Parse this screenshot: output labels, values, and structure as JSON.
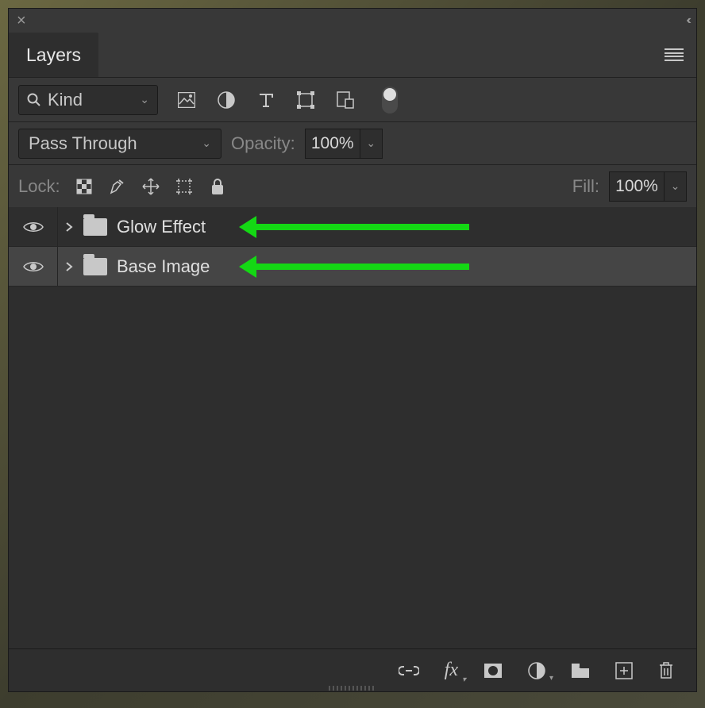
{
  "window": {
    "close": "×",
    "collapse": "‹‹"
  },
  "tabs": {
    "active": "Layers"
  },
  "filter": {
    "kind_label": "Kind",
    "icons": {
      "pixel": "pixel-layer-filter",
      "adjustment": "adjustment-layer-filter",
      "type": "type-layer-filter",
      "shape": "shape-layer-filter",
      "smart": "smart-object-filter"
    }
  },
  "blend": {
    "mode": "Pass Through",
    "opacity_label": "Opacity:",
    "opacity_value": "100%"
  },
  "lock": {
    "label": "Lock:",
    "fill_label": "Fill:",
    "fill_value": "100%"
  },
  "layers": [
    {
      "name": "Glow Effect",
      "type": "group",
      "selected": false,
      "visible": true,
      "annotated": true
    },
    {
      "name": "Base Image",
      "type": "group",
      "selected": true,
      "visible": true,
      "annotated": true
    }
  ],
  "annotation": {
    "arrow_color": "#14d814"
  },
  "bottom": {
    "link": "link-layers",
    "fx": "fx",
    "mask": "add-mask",
    "adjust": "new-adjustment",
    "group": "new-group",
    "new": "new-layer",
    "delete": "delete-layer"
  }
}
